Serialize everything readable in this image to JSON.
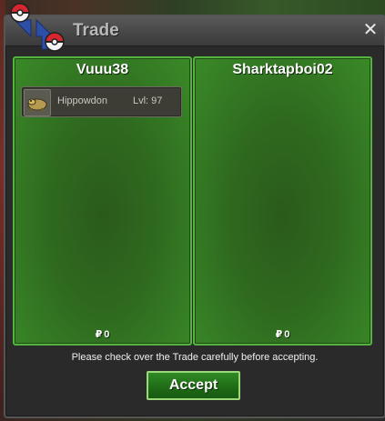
{
  "window": {
    "title": "Trade",
    "close_label": "✕"
  },
  "left_panel": {
    "player_name": "Vuuu38",
    "items": [
      {
        "name": "Hippowdon",
        "level": "Lvl: 97",
        "icon": "hippowdon-sprite-icon"
      }
    ],
    "money_symbol": "₽",
    "money": "0"
  },
  "right_panel": {
    "player_name": "Sharktapboi02",
    "items": [],
    "money_symbol": "₽",
    "money": "0"
  },
  "notice": "Please check over the Trade carefully before accepting.",
  "accept_label": "Accept",
  "colors": {
    "panel_green": "#2f6a1f",
    "panel_border": "#54b23e",
    "accept_green": "#1f6a16",
    "title_text": "#b9b9b9"
  }
}
